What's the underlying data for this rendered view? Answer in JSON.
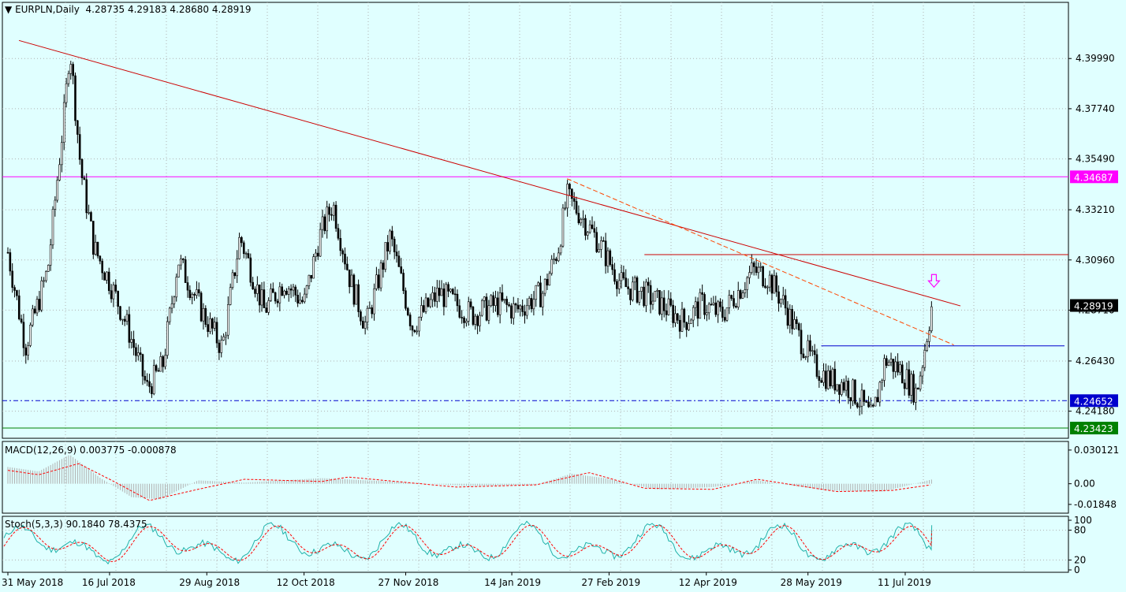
{
  "chart_data": {
    "type": "candlestick",
    "symbol": "EURPLN",
    "timeframe": "Daily",
    "ohlc": {
      "open": "4.28735",
      "high": "4.29183",
      "low": "4.28680",
      "close": "4.28919"
    },
    "price_axis": {
      "ylim": [
        4.23,
        4.412
      ],
      "ticks": [
        "4.39990",
        "4.37740",
        "4.35490",
        "4.33210",
        "4.30960",
        "4.28710",
        "4.26430",
        "4.24180"
      ]
    },
    "date_labels": [
      "31 May 2018",
      "16 Jul 2018",
      "29 Aug 2018",
      "12 Oct 2018",
      "27 Nov 2018",
      "14 Jan 2019",
      "27 Feb 2019",
      "12 Apr 2019",
      "28 May 2019",
      "11 Jul 2019"
    ],
    "price_tags": [
      {
        "value": "4.34687",
        "color": "#ff00ff"
      },
      {
        "value": "4.28919",
        "color": "#000000"
      },
      {
        "value": "4.24652",
        "color": "#0000cd"
      },
      {
        "value": "4.23423",
        "color": "#008000"
      }
    ],
    "level_lines": [
      {
        "price": 4.34687,
        "color": "#ff00ff",
        "style": "solid"
      },
      {
        "price": 4.24652,
        "color": "#0000cd",
        "style": "dash-dot"
      },
      {
        "price": 4.23423,
        "color": "#008000",
        "style": "solid"
      },
      {
        "price": 4.312,
        "color": "#cc0000",
        "style": "solid",
        "from": "2019-03-15"
      },
      {
        "price": 4.2711,
        "color": "#0000cd",
        "style": "solid",
        "from": "2019-06-03"
      }
    ],
    "trendlines": [
      {
        "from": [
          "2018-06-05",
          4.408
        ],
        "to": [
          "2019-08-05",
          4.289
        ],
        "color": "#cc0000",
        "style": "solid"
      },
      {
        "from": [
          "2019-02-08",
          4.346
        ],
        "to": [
          "2019-08-02",
          4.2715
        ],
        "color": "#ff4500",
        "style": "dashed"
      }
    ],
    "close_series": [
      {
        "date": "2018-05-31",
        "close": 4.313
      },
      {
        "date": "2018-06-08",
        "close": 4.271
      },
      {
        "date": "2018-06-18",
        "close": 4.305
      },
      {
        "date": "2018-06-26",
        "close": 4.38
      },
      {
        "date": "2018-06-28",
        "close": 4.406
      },
      {
        "date": "2018-07-03",
        "close": 4.35
      },
      {
        "date": "2018-07-09",
        "close": 4.315
      },
      {
        "date": "2018-07-16",
        "close": 4.3
      },
      {
        "date": "2018-07-24",
        "close": 4.28
      },
      {
        "date": "2018-08-02",
        "close": 4.252
      },
      {
        "date": "2018-08-09",
        "close": 4.262
      },
      {
        "date": "2018-08-16",
        "close": 4.31
      },
      {
        "date": "2018-08-27",
        "close": 4.286
      },
      {
        "date": "2018-09-05",
        "close": 4.27
      },
      {
        "date": "2018-09-13",
        "close": 4.32
      },
      {
        "date": "2018-09-24",
        "close": 4.287
      },
      {
        "date": "2018-10-03",
        "close": 4.3
      },
      {
        "date": "2018-10-12",
        "close": 4.29
      },
      {
        "date": "2018-10-19",
        "close": 4.32
      },
      {
        "date": "2018-10-25",
        "close": 4.335
      },
      {
        "date": "2018-11-02",
        "close": 4.3
      },
      {
        "date": "2018-11-09",
        "close": 4.28
      },
      {
        "date": "2018-11-20",
        "close": 4.32
      },
      {
        "date": "2018-11-30",
        "close": 4.28
      },
      {
        "date": "2018-12-12",
        "close": 4.295
      },
      {
        "date": "2018-12-27",
        "close": 4.285
      },
      {
        "date": "2019-01-08",
        "close": 4.29
      },
      {
        "date": "2019-01-16",
        "close": 4.287
      },
      {
        "date": "2019-01-28",
        "close": 4.295
      },
      {
        "date": "2019-02-04",
        "close": 4.315
      },
      {
        "date": "2019-02-08",
        "close": 4.338
      },
      {
        "date": "2019-02-14",
        "close": 4.33
      },
      {
        "date": "2019-02-22",
        "close": 4.318
      },
      {
        "date": "2019-03-05",
        "close": 4.298
      },
      {
        "date": "2019-03-14",
        "close": 4.295
      },
      {
        "date": "2019-03-22",
        "close": 4.29
      },
      {
        "date": "2019-04-02",
        "close": 4.282
      },
      {
        "date": "2019-04-10",
        "close": 4.29
      },
      {
        "date": "2019-04-19",
        "close": 4.285
      },
      {
        "date": "2019-04-26",
        "close": 4.295
      },
      {
        "date": "2019-05-03",
        "close": 4.305
      },
      {
        "date": "2019-05-10",
        "close": 4.302
      },
      {
        "date": "2019-05-17",
        "close": 4.29
      },
      {
        "date": "2019-05-24",
        "close": 4.275
      },
      {
        "date": "2019-05-31",
        "close": 4.262
      },
      {
        "date": "2019-06-07",
        "close": 4.256
      },
      {
        "date": "2019-06-14",
        "close": 4.254
      },
      {
        "date": "2019-06-21",
        "close": 4.246
      },
      {
        "date": "2019-06-26",
        "close": 4.238
      },
      {
        "date": "2019-07-02",
        "close": 4.265
      },
      {
        "date": "2019-07-09",
        "close": 4.26
      },
      {
        "date": "2019-07-16",
        "close": 4.25
      },
      {
        "date": "2019-07-19",
        "close": 4.265
      },
      {
        "date": "2019-07-23",
        "close": 4.2892
      }
    ],
    "macd": {
      "label": "MACD(12,26,9) 0.003775 -0.000878",
      "ticks": [
        "0.030121",
        "0.00",
        "-0.01848"
      ],
      "ylim": [
        -0.0235,
        0.035
      ],
      "histogram": [
        {
          "date": "2018-05-31",
          "value": 0.015
        },
        {
          "date": "2018-06-14",
          "value": 0.011
        },
        {
          "date": "2018-06-28",
          "value": 0.026
        },
        {
          "date": "2018-07-12",
          "value": 0.005
        },
        {
          "date": "2018-07-26",
          "value": -0.012
        },
        {
          "date": "2018-08-08",
          "value": -0.014
        },
        {
          "date": "2018-08-25",
          "value": 0.003
        },
        {
          "date": "2018-09-15",
          "value": 0.001
        },
        {
          "date": "2018-10-20",
          "value": 0.005
        },
        {
          "date": "2018-11-20",
          "value": 0.002
        },
        {
          "date": "2018-12-25",
          "value": -0.002
        },
        {
          "date": "2019-01-25",
          "value": -0.001
        },
        {
          "date": "2019-02-10",
          "value": 0.009
        },
        {
          "date": "2019-02-25",
          "value": 0.005
        },
        {
          "date": "2019-03-20",
          "value": -0.005
        },
        {
          "date": "2019-04-15",
          "value": -0.003
        },
        {
          "date": "2019-05-05",
          "value": 0.003
        },
        {
          "date": "2019-06-05",
          "value": -0.006
        },
        {
          "date": "2019-07-01",
          "value": -0.007
        },
        {
          "date": "2019-07-23",
          "value": 0.0038
        }
      ],
      "signal": [
        {
          "date": "2018-05-31",
          "value": 0.012
        },
        {
          "date": "2018-06-14",
          "value": 0.008
        },
        {
          "date": "2018-07-02",
          "value": 0.018
        },
        {
          "date": "2018-07-18",
          "value": 0.002
        },
        {
          "date": "2018-08-03",
          "value": -0.015
        },
        {
          "date": "2018-08-25",
          "value": -0.005
        },
        {
          "date": "2018-09-15",
          "value": 0.004
        },
        {
          "date": "2018-10-20",
          "value": 0.002
        },
        {
          "date": "2018-11-01",
          "value": 0.006
        },
        {
          "date": "2018-12-20",
          "value": -0.003
        },
        {
          "date": "2019-01-25",
          "value": -0.001
        },
        {
          "date": "2019-02-18",
          "value": 0.01
        },
        {
          "date": "2019-03-15",
          "value": -0.004
        },
        {
          "date": "2019-04-15",
          "value": -0.005
        },
        {
          "date": "2019-05-05",
          "value": 0.004
        },
        {
          "date": "2019-06-10",
          "value": -0.007
        },
        {
          "date": "2019-07-05",
          "value": -0.006
        },
        {
          "date": "2019-07-23",
          "value": -0.0009
        }
      ]
    },
    "stoch": {
      "label": "Stoch(5,3,3) 90.1840 78.4375",
      "ticks": [
        "100",
        "80",
        "20",
        "0"
      ],
      "ylim": [
        0,
        100
      ],
      "last": {
        "main": 90.184,
        "signal": 78.4375
      }
    },
    "annotations": [
      {
        "kind": "arrow-down",
        "date": "2019-07-24",
        "price": 4.296,
        "color": "#ff00ff"
      }
    ]
  }
}
